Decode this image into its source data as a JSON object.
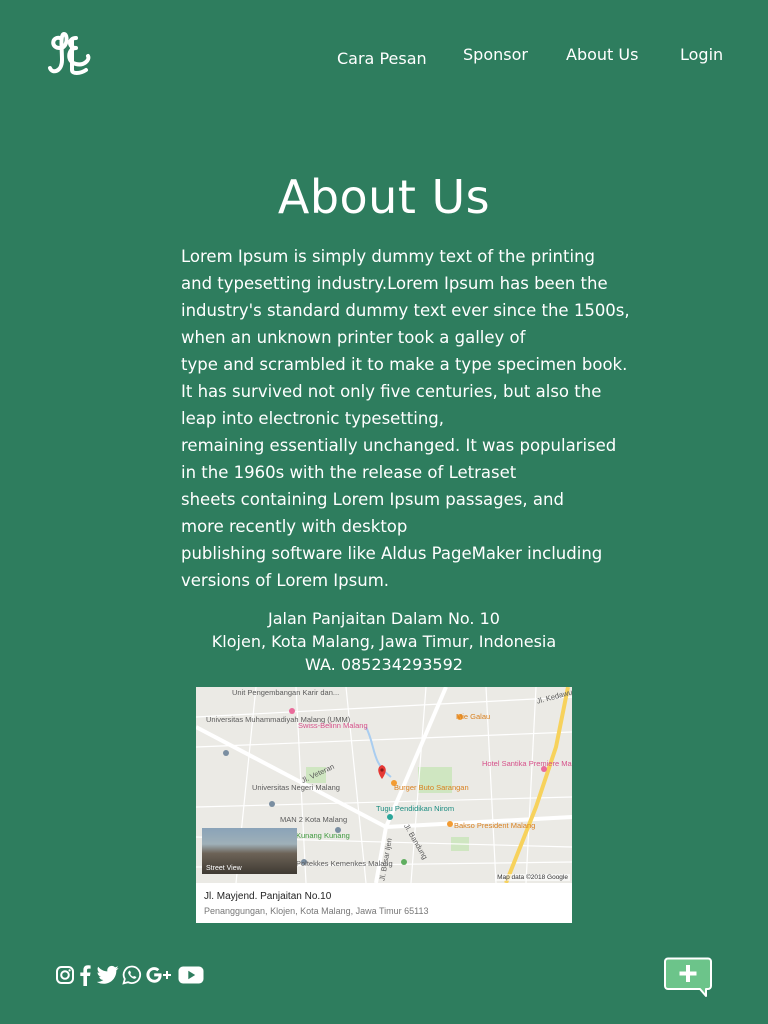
{
  "header": {
    "logo": "logo-monogram",
    "nav": [
      "Cara Pesan",
      "Sponsor",
      "About Us",
      "Login"
    ]
  },
  "main": {
    "title": "About Us",
    "paragraph_lines": [
      "Lorem Ipsum is simply dummy text of the printing",
      "and typesetting industry.Lorem Ipsum has been the",
      "industry's standard dummy text ever since the 1500s,",
      "when an unknown printer took a galley of",
      "type and scrambled it to make a type specimen book.",
      "It has survived not only five centuries, but also the",
      "leap into electronic typesetting,",
      "remaining essentially unchanged. It was popularised",
      "in the 1960s with the release of Letraset",
      "sheets containing Lorem Ipsum passages, and",
      "more recently with desktop",
      "publishing software like Aldus PageMaker including",
      "versions of Lorem Ipsum."
    ],
    "address": {
      "line1": "Jalan Panjaitan Dalam No. 10",
      "line2": "Klojen, Kota Malang, Jawa Timur, Indonesia",
      "phone": "WA. 085234293592"
    }
  },
  "map": {
    "labels": [
      "Unit Pengembangan Karir dan...",
      "Universitas Muhammadiyah Malang (UMM)",
      "Swiss-Belinn Malang",
      "Mie Galau",
      "Hotel Santika Premiere Malang",
      "Universitas Negeri Malang",
      "Burger Buto Sarangan",
      "Tugu Pendidikan Nirom",
      "MAN 2 Kota Malang",
      "Bakso President Malang",
      "Kunang Kunang",
      "Poltekkes Kemenkes Malang",
      "Jl. Veteran",
      "Jl. Kedawung",
      "Jl. Besar Ijen",
      "Jl. Bandung"
    ],
    "street_view": "Street View",
    "attribution": "Map data ©2018 Google",
    "place_name": "Jl. Mayjend. Panjaitan No.10",
    "place_address": "Penanggungan, Klojen, Kota Malang, Jawa Timur 65113"
  },
  "footer": {
    "social_icons": [
      "instagram-icon",
      "facebook-icon",
      "twitter-icon",
      "whatsapp-icon",
      "google-plus-icon",
      "youtube-icon"
    ],
    "chat_button": "chat-plus-icon"
  },
  "colors": {
    "background": "#2e7d5e",
    "text": "#ffffff",
    "chat_button": "#6cc48a"
  }
}
